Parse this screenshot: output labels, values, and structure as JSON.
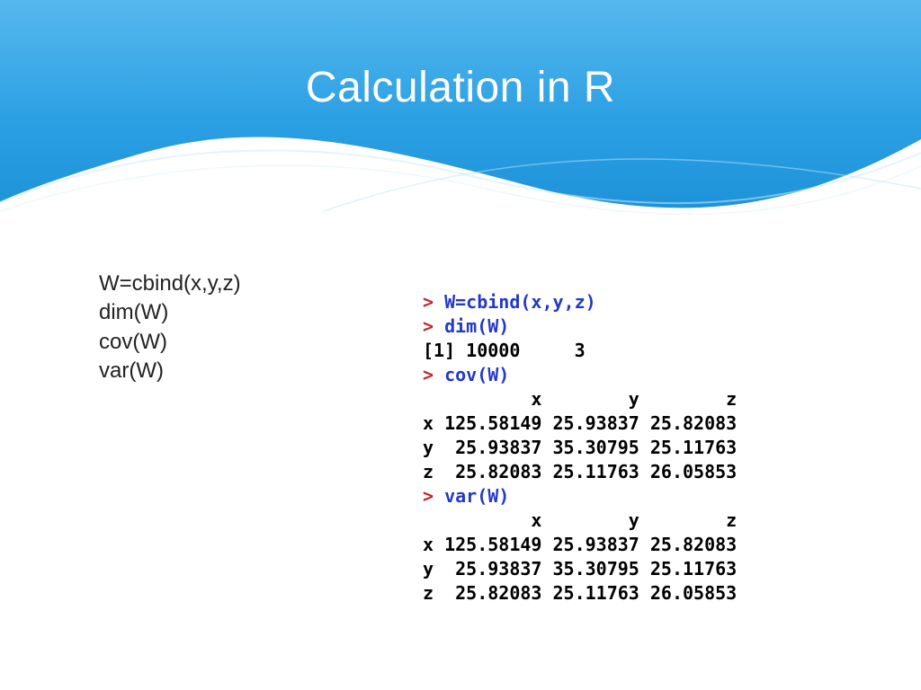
{
  "title": "Calculation in R",
  "left_code": {
    "l1": "W=cbind(x,y,z)",
    "l2": "dim(W)",
    "l3": "cov(W)",
    "l4": "var(W)"
  },
  "console": {
    "prompt": "> ",
    "cmd1": "W=cbind(x,y,z)",
    "cmd2": "dim(W)",
    "out_dim": "[1] 10000     3",
    "cmd3": "cov(W)",
    "cov_header": "          x        y        z",
    "cov_x": "x 125.58149 25.93837 25.82083",
    "cov_y": "y  25.93837 35.30795 25.11763",
    "cov_z": "z  25.82083 25.11763 26.05853",
    "cmd4": "var(W)",
    "var_header": "          x        y        z",
    "var_x": "x 125.58149 25.93837 25.82083",
    "var_y": "y  25.93837 35.30795 25.11763",
    "var_z": "z  25.82083 25.11763 26.05853"
  }
}
